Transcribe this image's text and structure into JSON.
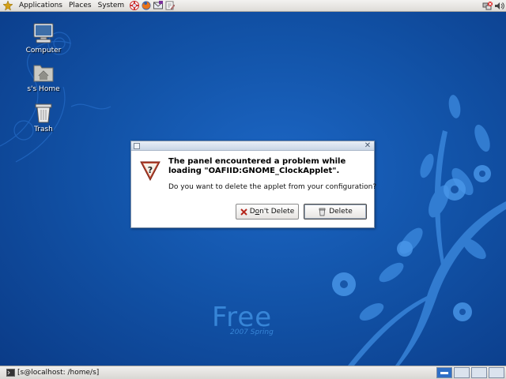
{
  "top_panel": {
    "menus": [
      "Applications",
      "Places",
      "System"
    ],
    "logo_icon": "foot-logo-icon",
    "launchers": [
      "lifebuoy-help-icon",
      "firefox-icon",
      "mail-icon",
      "edit-note-icon"
    ],
    "tray_icons": [
      "network-disconnected-icon",
      "volume-icon"
    ]
  },
  "desktop_icons": [
    {
      "label": "Computer",
      "icon": "computer-icon"
    },
    {
      "label": "s's Home",
      "icon": "home-folder-icon"
    },
    {
      "label": "Trash",
      "icon": "trash-icon"
    }
  ],
  "wallpaper": {
    "brand": "Free",
    "subtitle": "2007 Spring"
  },
  "dialog": {
    "heading": "The panel encountered a problem while loading \"OAFIID:GNOME_ClockApplet\".",
    "question": "Do you want to delete the applet from your configuration?",
    "dont_delete_label": "Don't Delete",
    "dont_delete_mnemonic": "o",
    "delete_label": "Delete",
    "icon": "warning-question-icon"
  },
  "bottom_panel": {
    "task_label": "[s@localhost: /home/s]",
    "workspaces": 4,
    "active_workspace": 1
  },
  "colors": {
    "wallpaper_blue": "#1253a8",
    "panel_bg": "#e6e4e0",
    "workspace_active": "#2f6fc6"
  }
}
